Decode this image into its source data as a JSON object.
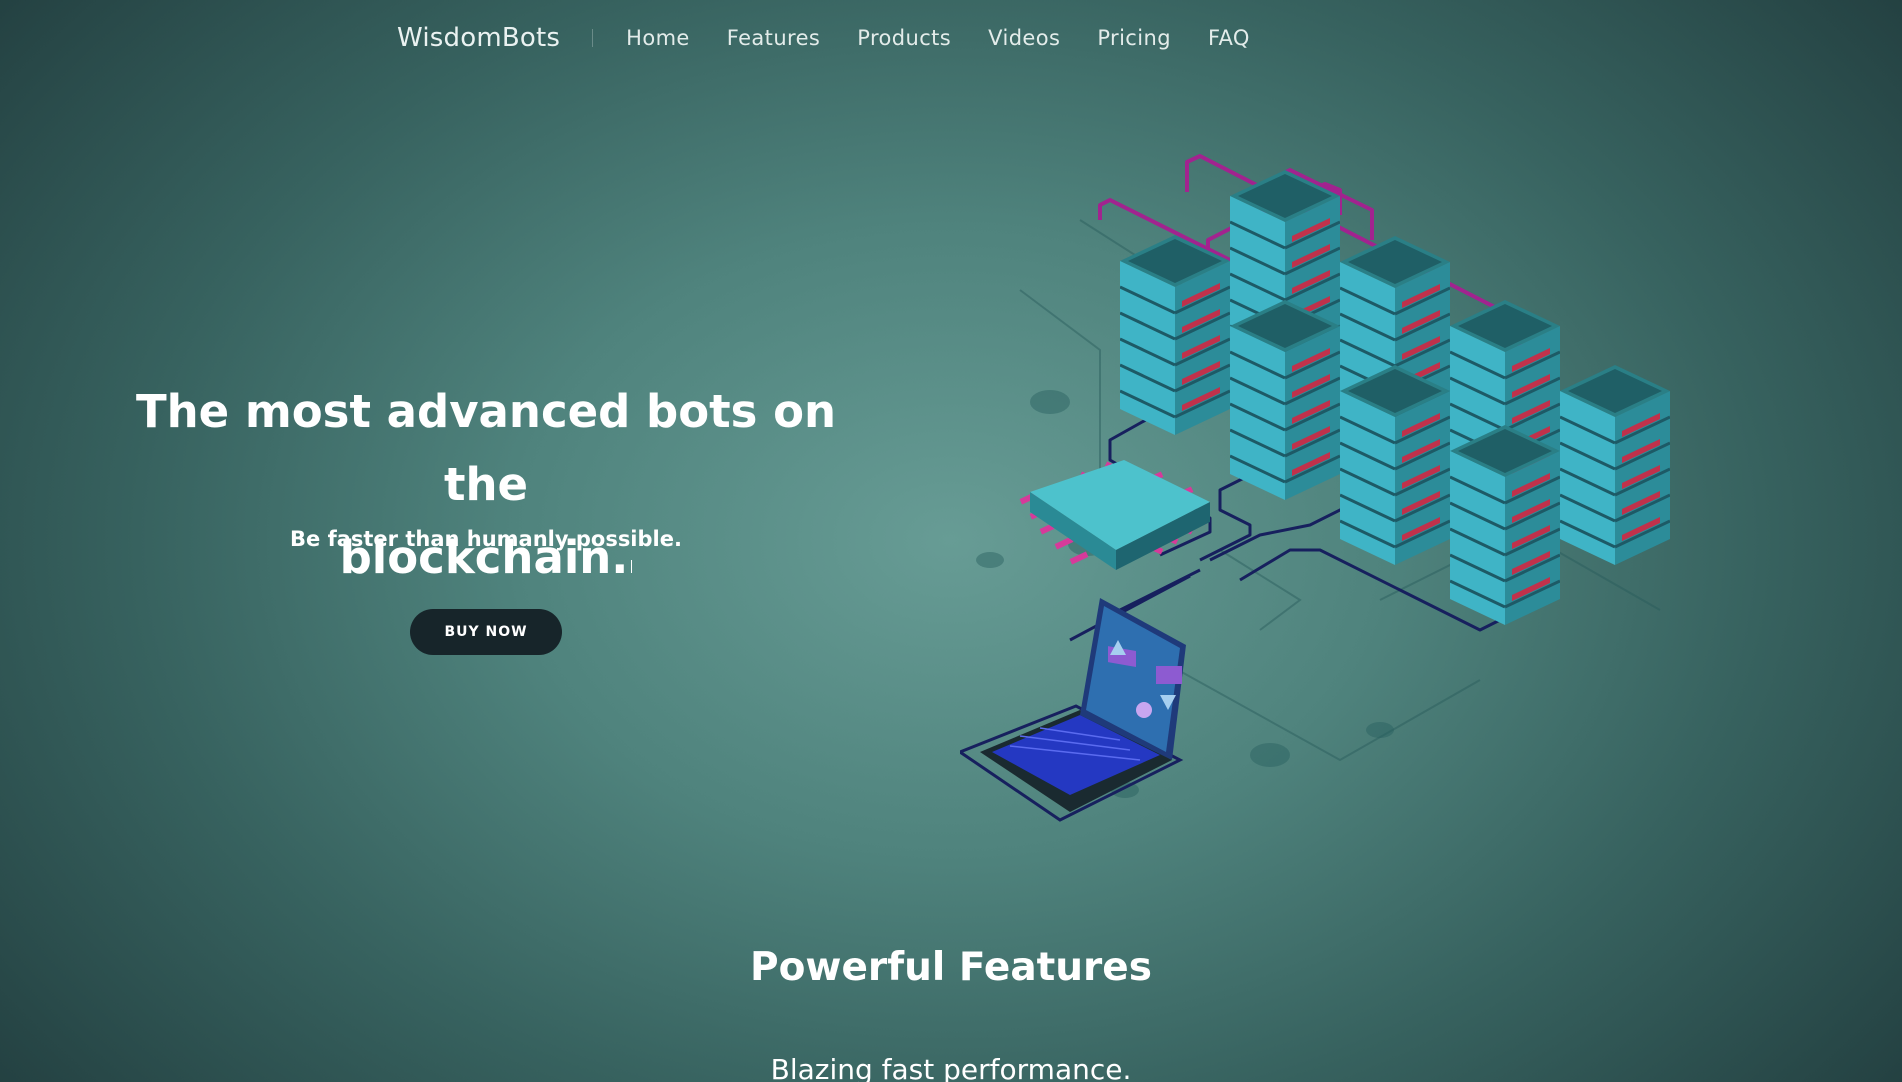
{
  "nav": {
    "brand": "WisdomBots",
    "links": [
      "Home",
      "Features",
      "Products",
      "Videos",
      "Pricing",
      "FAQ"
    ]
  },
  "hero": {
    "title_line1": "The most advanced bots on the",
    "title_line2": "blockchain.",
    "subtitle": "Be faster than humanly possible.",
    "cta_label": "BUY NOW",
    "illustration_icon": "servers-chip-laptop-illustration"
  },
  "features": {
    "title": "Powerful Features",
    "first_item": "Blazing fast performance."
  },
  "colors": {
    "background_center": "#679c95",
    "background_edge": "#223e3f",
    "button_bg": "#17252a",
    "server_teal": "#3fb4c6",
    "server_red_leds": "#c0314b",
    "wire_magenta": "#a2238f",
    "wire_navy": "#17205e",
    "chip_pins": "#d63a9a",
    "laptop_keys": "#3b3bd8"
  }
}
